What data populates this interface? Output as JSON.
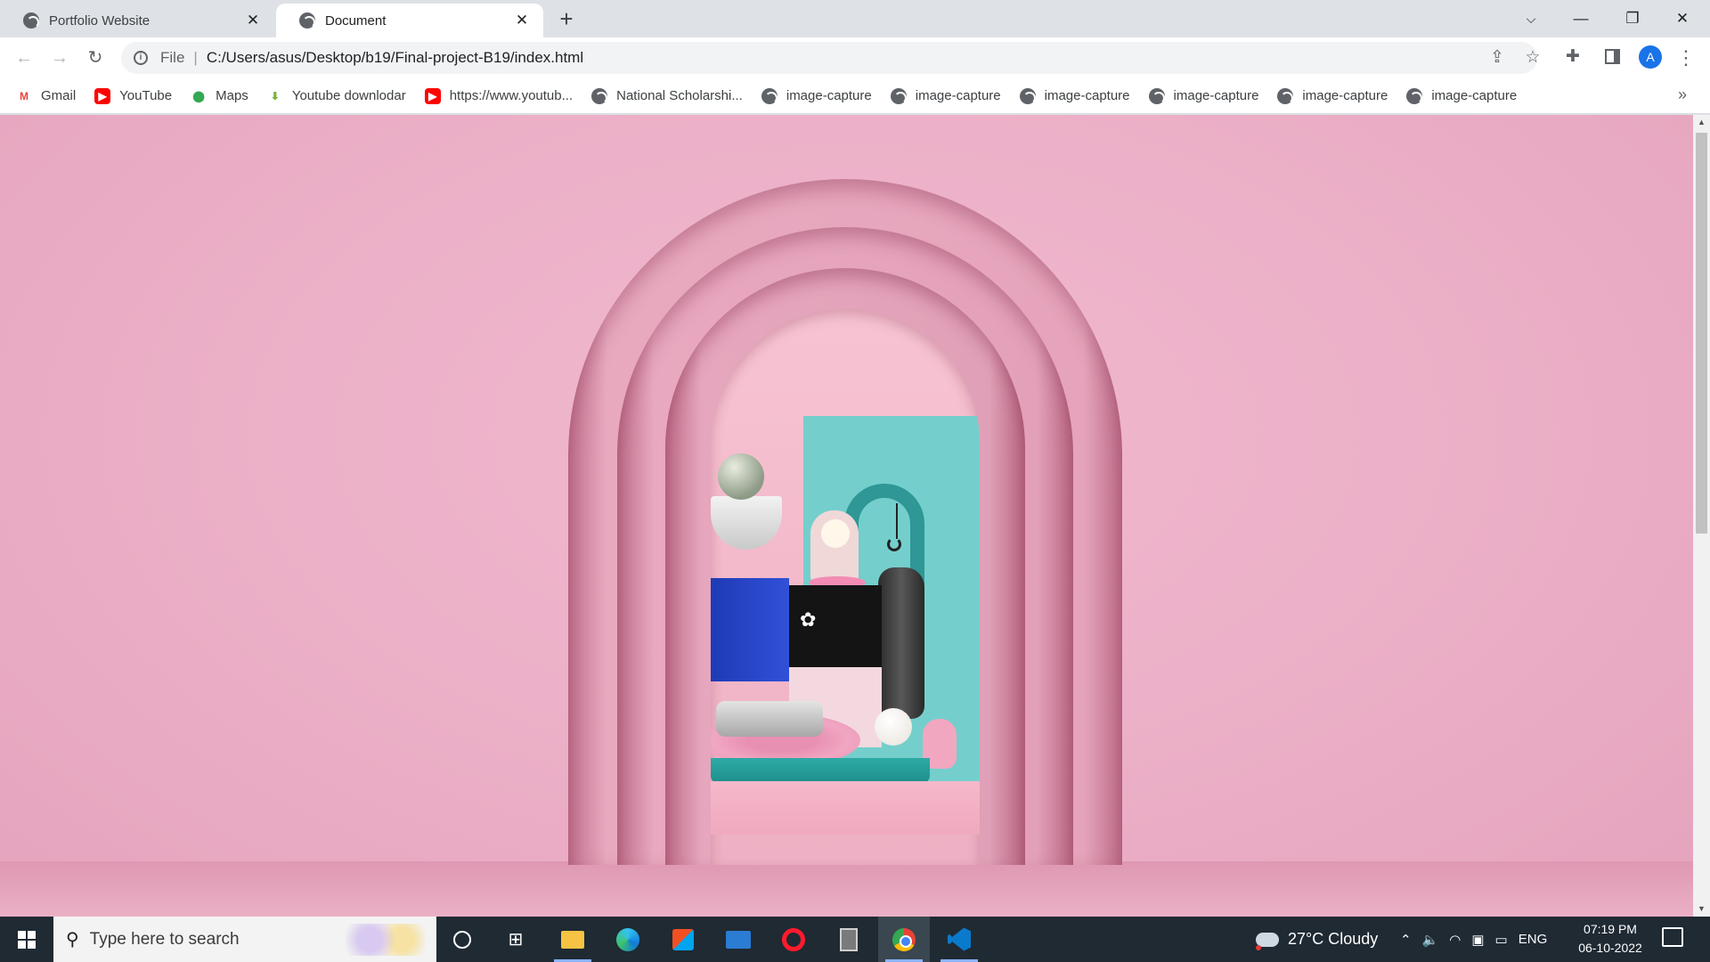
{
  "browser": {
    "tabs": [
      {
        "title": "Portfolio Website",
        "active": false
      },
      {
        "title": "Document",
        "active": true
      }
    ],
    "new_tab_label": "+",
    "address": {
      "scheme_label": "File",
      "url": "C:/Users/asus/Desktop/b19/Final-project-B19/index.html"
    },
    "profile_initial": "A",
    "bookmarks": [
      {
        "label": "Gmail",
        "icon": "gmail-icon"
      },
      {
        "label": "YouTube",
        "icon": "youtube-icon"
      },
      {
        "label": "Maps",
        "icon": "maps-icon"
      },
      {
        "label": "Youtube downlodar",
        "icon": "download-icon"
      },
      {
        "label": "https://www.youtub...",
        "icon": "youtube-icon"
      },
      {
        "label": "National Scholarshi...",
        "icon": "globe-icon"
      },
      {
        "label": "image-capture",
        "icon": "globe-icon"
      },
      {
        "label": "image-capture",
        "icon": "globe-icon"
      },
      {
        "label": "image-capture",
        "icon": "globe-icon"
      },
      {
        "label": "image-capture",
        "icon": "globe-icon"
      },
      {
        "label": "image-capture",
        "icon": "globe-icon"
      },
      {
        "label": "image-capture",
        "icon": "globe-icon"
      }
    ],
    "bookmarks_overflow": "»"
  },
  "page": {
    "hero_image": "pink arch scene",
    "colors": {
      "background": "#ecb1c8",
      "accent_teal": "#74cfcc"
    }
  },
  "taskbar": {
    "search_placeholder": "Type here to search",
    "weather": "27°C  Cloudy",
    "language": "ENG",
    "time": "07:19 PM",
    "date": "06-10-2022"
  }
}
